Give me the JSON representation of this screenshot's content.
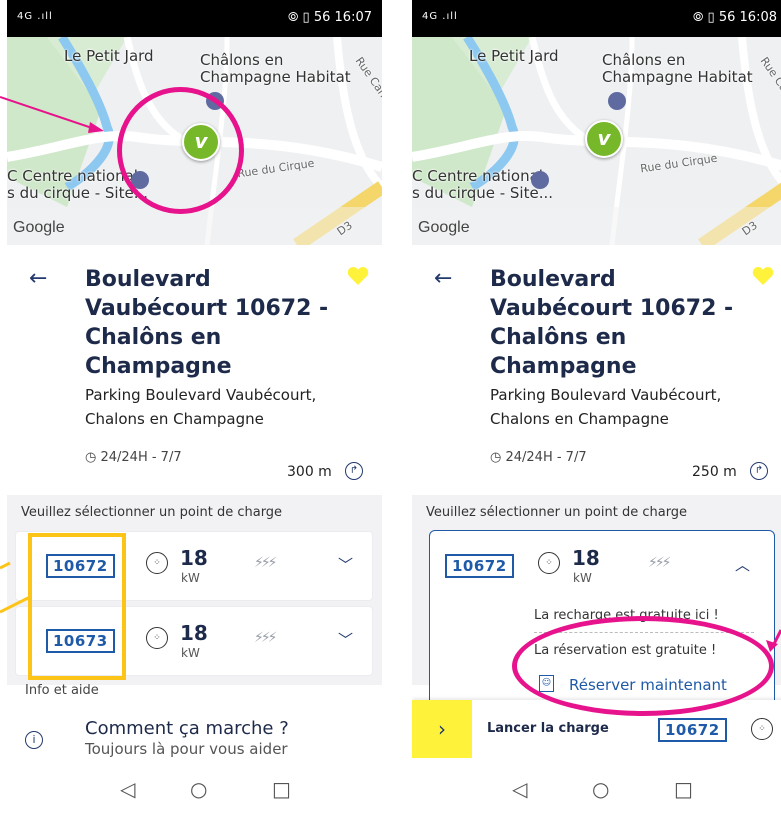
{
  "screen1": {
    "status": {
      "signal": "4G .ıll",
      "time": "16:07",
      "icons": "⦾ ▯ 56"
    },
    "map": {
      "labels": [
        "Le Petit Jard",
        "Châlons en",
        "Champagne Habitat",
        "C Centre national",
        "s du cirque - Site...",
        "Rue du Cirque",
        "Rue Carnot",
        "D3"
      ],
      "google": "Google"
    },
    "station": {
      "title": "Boulevard Vaubécourt 10672 - Chalôns en Champagne",
      "address": "Parking Boulevard Vaubécourt, Chalons en Champagne",
      "hours": "24/24H - 7/7",
      "distance": "300 m"
    },
    "select_prompt": "Veuillez sélectionner un point de charge",
    "points": [
      {
        "id": "10672",
        "power": "18",
        "unit": "kW"
      },
      {
        "id": "10673",
        "power": "18",
        "unit": "kW"
      }
    ],
    "help": {
      "section": "Info et aide",
      "title": "Comment ça marche ?",
      "subtitle": "Toujours là pour vous aider"
    }
  },
  "screen2": {
    "status": {
      "signal": "4G .ıll",
      "time": "16:08",
      "icons": "⦾ ▯ 56"
    },
    "map": {
      "labels": [
        "Le Petit Jard",
        "Châlons en",
        "Champagne Habitat",
        "C Centre national",
        "s du cirque - Site...",
        "Rue du Cirque",
        "Rue Carnot",
        "D3"
      ],
      "google": "Google"
    },
    "station": {
      "title": "Boulevard Vaubécourt 10672 - Chalôns en Champagne",
      "address": "Parking Boulevard Vaubécourt, Chalons en Champagne",
      "hours": "24/24H - 7/7",
      "distance": "250 m"
    },
    "select_prompt": "Veuillez sélectionner un point de charge",
    "point": {
      "id": "10672",
      "power": "18",
      "unit": "kW"
    },
    "info_free": "La recharge est gratuite ici !",
    "info_reservation": "La réservation est gratuite !",
    "reserve_label": "Réserver maintenant",
    "bottom": {
      "action": "Lancer la charge",
      "id": "10672"
    }
  },
  "colors": {
    "brand_green": "#77b82a",
    "id_blue": "#1e5aa8",
    "accent_yellow": "#fff23a",
    "annotation_pink": "#e7138c",
    "annotation_yellow": "#fdc418"
  }
}
